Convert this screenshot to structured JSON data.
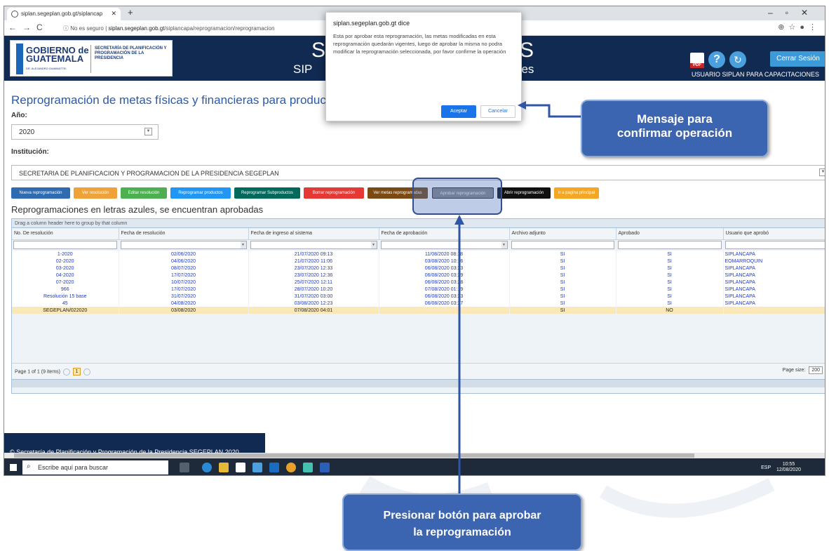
{
  "browser": {
    "tab_title": "siplan.segeplan.gob.gt/siplancap",
    "url_prefix": "No es seguro",
    "url_host": "siplan.segeplan.gob.gt",
    "url_path": "/siplancapa/reprogramacion/reprogramacion"
  },
  "banner": {
    "logo_title": "GOBIERNO de GUATEMALA",
    "logo_sub": "DR. ALEJANDRO GIAMMATTEI",
    "logo_sec": "SECRETARÍA DE PLANIFICACIÓN Y PROGRAMACIÓN DE LA PRESIDENCIA",
    "big_left": "S",
    "big_right": "S",
    "sub_left": "SIP",
    "sub_right": "nes",
    "pdf_label": "PDF",
    "close_session": "Cerrar Sesión",
    "user": "USUARIO SIPLAN PARA CAPACITACIONES"
  },
  "page": {
    "title": "Reprogramación de metas físicas y financieras para productos",
    "year_label": "Año:",
    "year_value": "2020",
    "institution_label": "Institución:",
    "institution_value": "SECRETARIA DE PLANIFICACION Y PROGRAMACION DE LA PRESIDENCIA SEGEPLAN",
    "subtitle": "Reprogramaciones en letras azules, se encuentran aprobadas"
  },
  "buttons": [
    {
      "label": "Nueva reprogramación",
      "color": "#2e6bb0"
    },
    {
      "label": "Ver resolución",
      "color": "#f0a23a"
    },
    {
      "label": "Editar resolución",
      "color": "#4caf50"
    },
    {
      "label": "Reprogramar productos",
      "color": "#2196f3"
    },
    {
      "label": "Reprogramar Subproductos",
      "color": "#00695c"
    },
    {
      "label": "Borrar reprogramación",
      "color": "#e53935"
    },
    {
      "label": "Ver metas reprogramadas",
      "color": "#7a4a12"
    },
    {
      "label": "Aprobar reprogramación",
      "color": "#8a8a8a"
    },
    {
      "label": "Abrir reprogramación",
      "color": "#111111"
    },
    {
      "label": "Ir a pagina principal",
      "color": "#f5a623"
    }
  ],
  "grid": {
    "group_hint": "Drag a column header here to group by that column",
    "columns": [
      "No. De resolución",
      "Fecha de resolución",
      "Fecha de ingreso al sistema",
      "Fecha de aprobación",
      "Archivo adjunto",
      "Aprobado",
      "Usuario que aprobó"
    ],
    "rows": [
      [
        "1-2020",
        "02/06/2020",
        "21/07/2020 09:13",
        "11/08/2020 08:18",
        "SI",
        "SI",
        "SIPLANCAPA"
      ],
      [
        "02-2020",
        "04/06/2020",
        "21/07/2020 11:06",
        "03/08/2020 10:16",
        "SI",
        "SI",
        "EOMARROQUIN"
      ],
      [
        "03-2020",
        "08/07/2020",
        "23/07/2020 12:33",
        "06/08/2020 03:23",
        "SI",
        "SI",
        "SIPLANCAPA"
      ],
      [
        "04-2020",
        "17/07/2020",
        "23/07/2020 12:36",
        "06/08/2020 03:29",
        "SI",
        "SI",
        "SIPLANCAPA"
      ],
      [
        "07-2020",
        "10/07/2020",
        "25/07/2020 12:11",
        "06/08/2020 03:28",
        "SI",
        "SI",
        "SIPLANCAPA"
      ],
      [
        "966",
        "17/07/2020",
        "28/07/2020 10:20",
        "07/08/2020 01:19",
        "SI",
        "SI",
        "SIPLANCAPA"
      ],
      [
        "Resolución 15 base",
        "31/07/2020",
        "31/07/2020 03:00",
        "06/08/2020 03:23",
        "SI",
        "SI",
        "SIPLANCAPA"
      ],
      [
        "45",
        "04/08/2020",
        "03/08/2020 12:23",
        "06/08/2020 03:27",
        "SI",
        "SI",
        "SIPLANCAPA"
      ],
      [
        "SEGEPLAN/022020",
        "03/08/2020",
        "07/08/2020 04:01",
        "",
        "SI",
        "NO",
        ""
      ]
    ],
    "pager_text": "Page 1 of 1 (9 items)",
    "current_page": "1",
    "page_size_label": "Page size:",
    "page_size": "200"
  },
  "footer": "© Secretaría de Planificación y Programación de la Presidencia SEGEPLAN 2020",
  "dialog": {
    "title": "siplan.segeplan.gob.gt dice",
    "message": "Esta por aprobar esta reprogramación, las metas modificadas en esta reprogramación quedarán vigentes, luego de aprobar la misma no podra modificar la reprogramación seleccionada, por favor confirme la operación",
    "ok": "Aceptar",
    "cancel": "Cancelar"
  },
  "taskbar": {
    "search_placeholder": "Escribe aquí para buscar",
    "tray_lang": "ESP",
    "time": "10:55",
    "date": "12/08/2020"
  },
  "callouts": {
    "top": "Mensaje para confirmar operación",
    "bottom": "Presionar botón para aprobar la reprogramación"
  },
  "colors": {
    "banner": "#112a52",
    "title_blue": "#2b5aa8",
    "callout": "#3b64b1",
    "highlight_row": "#fbe8b8"
  }
}
